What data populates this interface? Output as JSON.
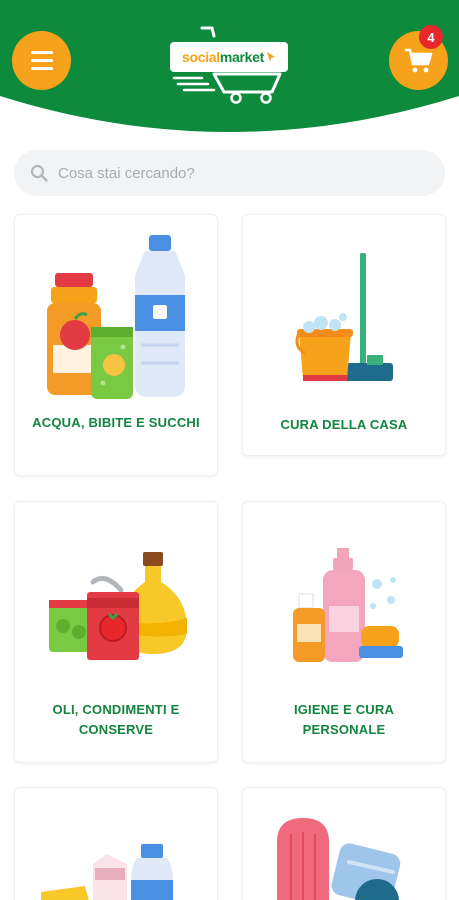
{
  "header": {
    "brand_color": "#0d8a3c",
    "accent_color": "#f6a21b",
    "logo": {
      "part1": "social",
      "part2": "market"
    },
    "cart_count": "4"
  },
  "search": {
    "placeholder": "Cosa stai cercando?"
  },
  "categories": [
    {
      "label": "ACQUA, BIBITE E SUCCHI",
      "icon": "drinks-illustration"
    },
    {
      "label": "CURA DELLA CASA",
      "icon": "home-cleaning-illustration"
    },
    {
      "label": "OLI, CONDIMENTI E CONSERVE",
      "icon": "oils-condiments-illustration"
    },
    {
      "label": "IGIENE E CURA PERSONALE",
      "icon": "personal-care-illustration"
    },
    {
      "label": "",
      "icon": "dairy-illustration"
    },
    {
      "label": "",
      "icon": "baby-care-illustration"
    }
  ]
}
